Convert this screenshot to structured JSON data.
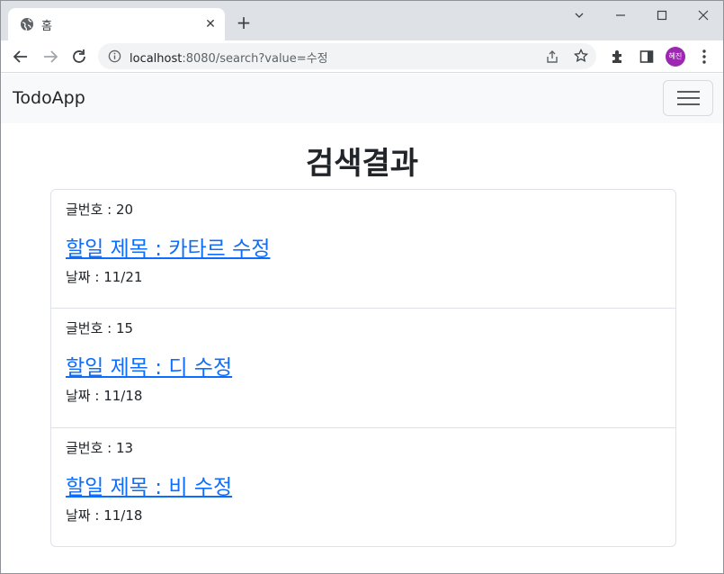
{
  "browser": {
    "tab_title": "홈",
    "url_host": "localhost",
    "url_rest": ":8080/search?value=수정",
    "profile_initials": "혜진"
  },
  "navbar": {
    "brand": "TodoApp"
  },
  "main": {
    "heading": "검색결과",
    "items": [
      {
        "number": "글번호 : 20",
        "title": "할일 제목 : 카타르 수정",
        "date": "날짜 : 11/21"
      },
      {
        "number": "글번호 : 15",
        "title": "할일 제목 : 디 수정",
        "date": "날짜 : 11/18"
      },
      {
        "number": "글번호 : 13",
        "title": "할일 제목 : 비 수정",
        "date": "날짜 : 11/18"
      }
    ]
  },
  "colors": {
    "link": "#0d6efd",
    "navbar_bg": "#f8f9fa",
    "avatar_bg": "#9c27b0"
  }
}
